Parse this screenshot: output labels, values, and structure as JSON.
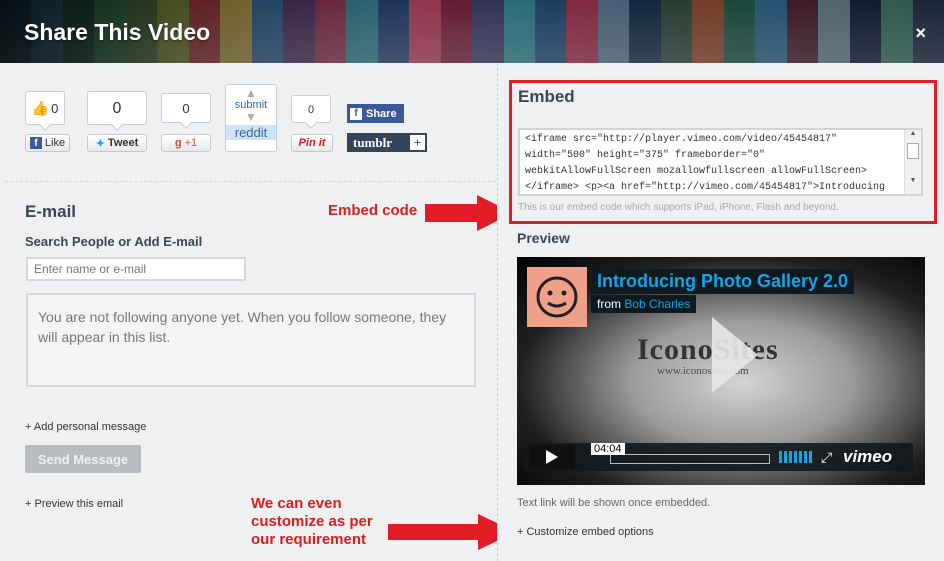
{
  "header": {
    "title": "Share This Video",
    "close": "×",
    "stripe_colors": [
      "#1a4d5a",
      "#2b6a8a",
      "#1f4f3f",
      "#2f7a4a",
      "#4a6b3a",
      "#7a8a3a",
      "#a83a3a",
      "#b8a04a",
      "#3a6a9a",
      "#5a3a6a",
      "#9a3a5a",
      "#3a8a9a",
      "#2a4a7a",
      "#c84a6a",
      "#8a2a4a",
      "#4a4a7a",
      "#3a9aaa",
      "#2a5a8a",
      "#b83a5a",
      "#6a8aaa",
      "#1a3a5a",
      "#3a5a4a",
      "#aa5a3a",
      "#2a6a5a",
      "#3a7aaa",
      "#5a2a3a",
      "#7a9aaa",
      "#1a2a4a",
      "#4a8a7a",
      "#2a3a5a"
    ]
  },
  "social": {
    "like_count": "0",
    "like_label": "Like",
    "tweet_count": "0",
    "tweet_label": "Tweet",
    "gplus_count": "0",
    "gplus_label": "+1",
    "reddit_top": "submit",
    "reddit_label": "reddit",
    "pin_count": "0",
    "pin_label": "Pin it",
    "fb_share_label": "Share",
    "tumblr_label": "tumblr"
  },
  "email": {
    "heading": "E-mail",
    "search_label": "Search People or Add E-mail",
    "input_placeholder": "Enter name or e-mail",
    "follow_text": "You are not following anyone yet. When you follow someone, they will appear in this list.",
    "add_message": "+ Add personal message",
    "send_button": "Send Message",
    "preview_link": "+ Preview this email"
  },
  "annotations": {
    "embed_code": "Embed code",
    "customize": "We can even customize as per our requirement"
  },
  "embed": {
    "heading": "Embed",
    "code": "<iframe src=\"http://player.vimeo.com/video/45454817\"\nwidth=\"500\" height=\"375\" frameborder=\"0\"\nwebkitAllowFullScreen mozallowfullscreen allowFullScreen>\n</iframe> <p><a href=\"http://vimeo.com/45454817\">Introducing",
    "hint": "This is our embed code which supports iPad, iPhone, Flash and beyond."
  },
  "preview": {
    "heading": "Preview",
    "video_title": "Introducing Photo Gallery 2.0",
    "from_prefix": "from",
    "from_author": "Bob Charles",
    "watermark": "IconoSites",
    "watermark_url": "www.iconosites.com",
    "time": "04:04",
    "logo": "vimeo",
    "textlink_note": "Text link will be shown once embedded.",
    "customize_link": "+ Customize embed options"
  }
}
